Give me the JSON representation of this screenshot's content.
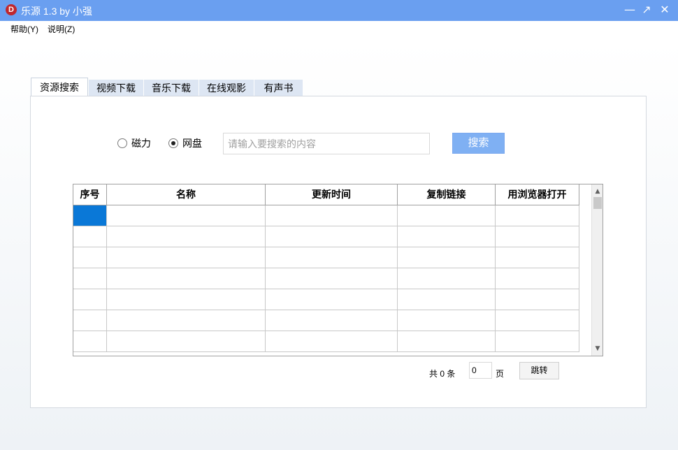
{
  "window": {
    "title": "乐源 1.3 by 小强",
    "app_icon_letter": "D",
    "minimize": "—",
    "maximize": "↗",
    "close": "✕"
  },
  "menu": {
    "help": "帮助(Y)",
    "about": "说明(Z)"
  },
  "tabs": [
    {
      "label": "资源搜索",
      "active": true
    },
    {
      "label": "视频下载"
    },
    {
      "label": "音乐下载"
    },
    {
      "label": "在线观影"
    },
    {
      "label": "有声书"
    }
  ],
  "search": {
    "options": [
      {
        "label": "磁力",
        "selected": false
      },
      {
        "label": "网盘",
        "selected": true
      }
    ],
    "placeholder": "请输入要搜索的内容",
    "value": "",
    "button": "搜索"
  },
  "table": {
    "columns": [
      "序号",
      "名称",
      "更新时间",
      "复制链接",
      "用浏览器打开"
    ],
    "rows": 7
  },
  "pager": {
    "total": "共 0 条",
    "page_value": "0",
    "page_label": "页",
    "jump": "跳转"
  }
}
